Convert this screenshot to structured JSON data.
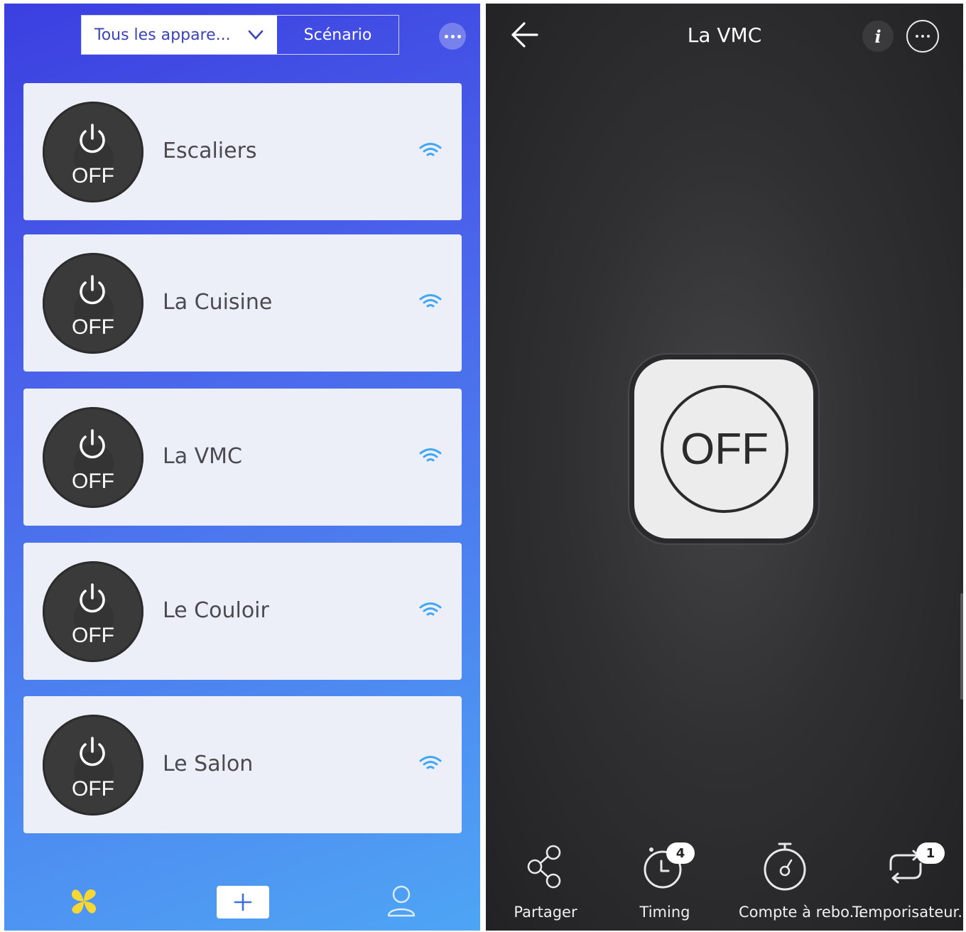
{
  "left": {
    "segment": {
      "all_devices": "Tous les appare...",
      "scenario": "Scénario"
    },
    "off_label": "OFF",
    "devices": [
      {
        "name": "Escaliers",
        "state": "OFF"
      },
      {
        "name": "La Cuisine",
        "state": "OFF"
      },
      {
        "name": "La VMC",
        "state": "OFF"
      },
      {
        "name": "Le Couloir",
        "state": "OFF"
      },
      {
        "name": "Le Salon",
        "state": "OFF"
      }
    ],
    "nav": {
      "home_icon": "clover-icon",
      "add_icon": "plus-icon",
      "profile_icon": "profile-icon"
    },
    "colors": {
      "gradient_top": "#3b3fe0",
      "gradient_bottom": "#4ea5f4",
      "wifi": "#3ea6f5",
      "knob": "#3a3a3a"
    }
  },
  "right": {
    "title": "La VMC",
    "info_label": "i",
    "switch_state": "OFF",
    "actions": [
      {
        "label": "Partager",
        "icon": "share-icon"
      },
      {
        "label": "Timing",
        "icon": "timer-icon",
        "badge": "4"
      },
      {
        "label": "Compte à rebo...",
        "icon": "stopwatch-icon"
      },
      {
        "label": "Temporisateur...",
        "icon": "loop-icon",
        "badge": "1"
      }
    ],
    "colors": {
      "background": "#303032",
      "plate": "#ececec"
    }
  }
}
